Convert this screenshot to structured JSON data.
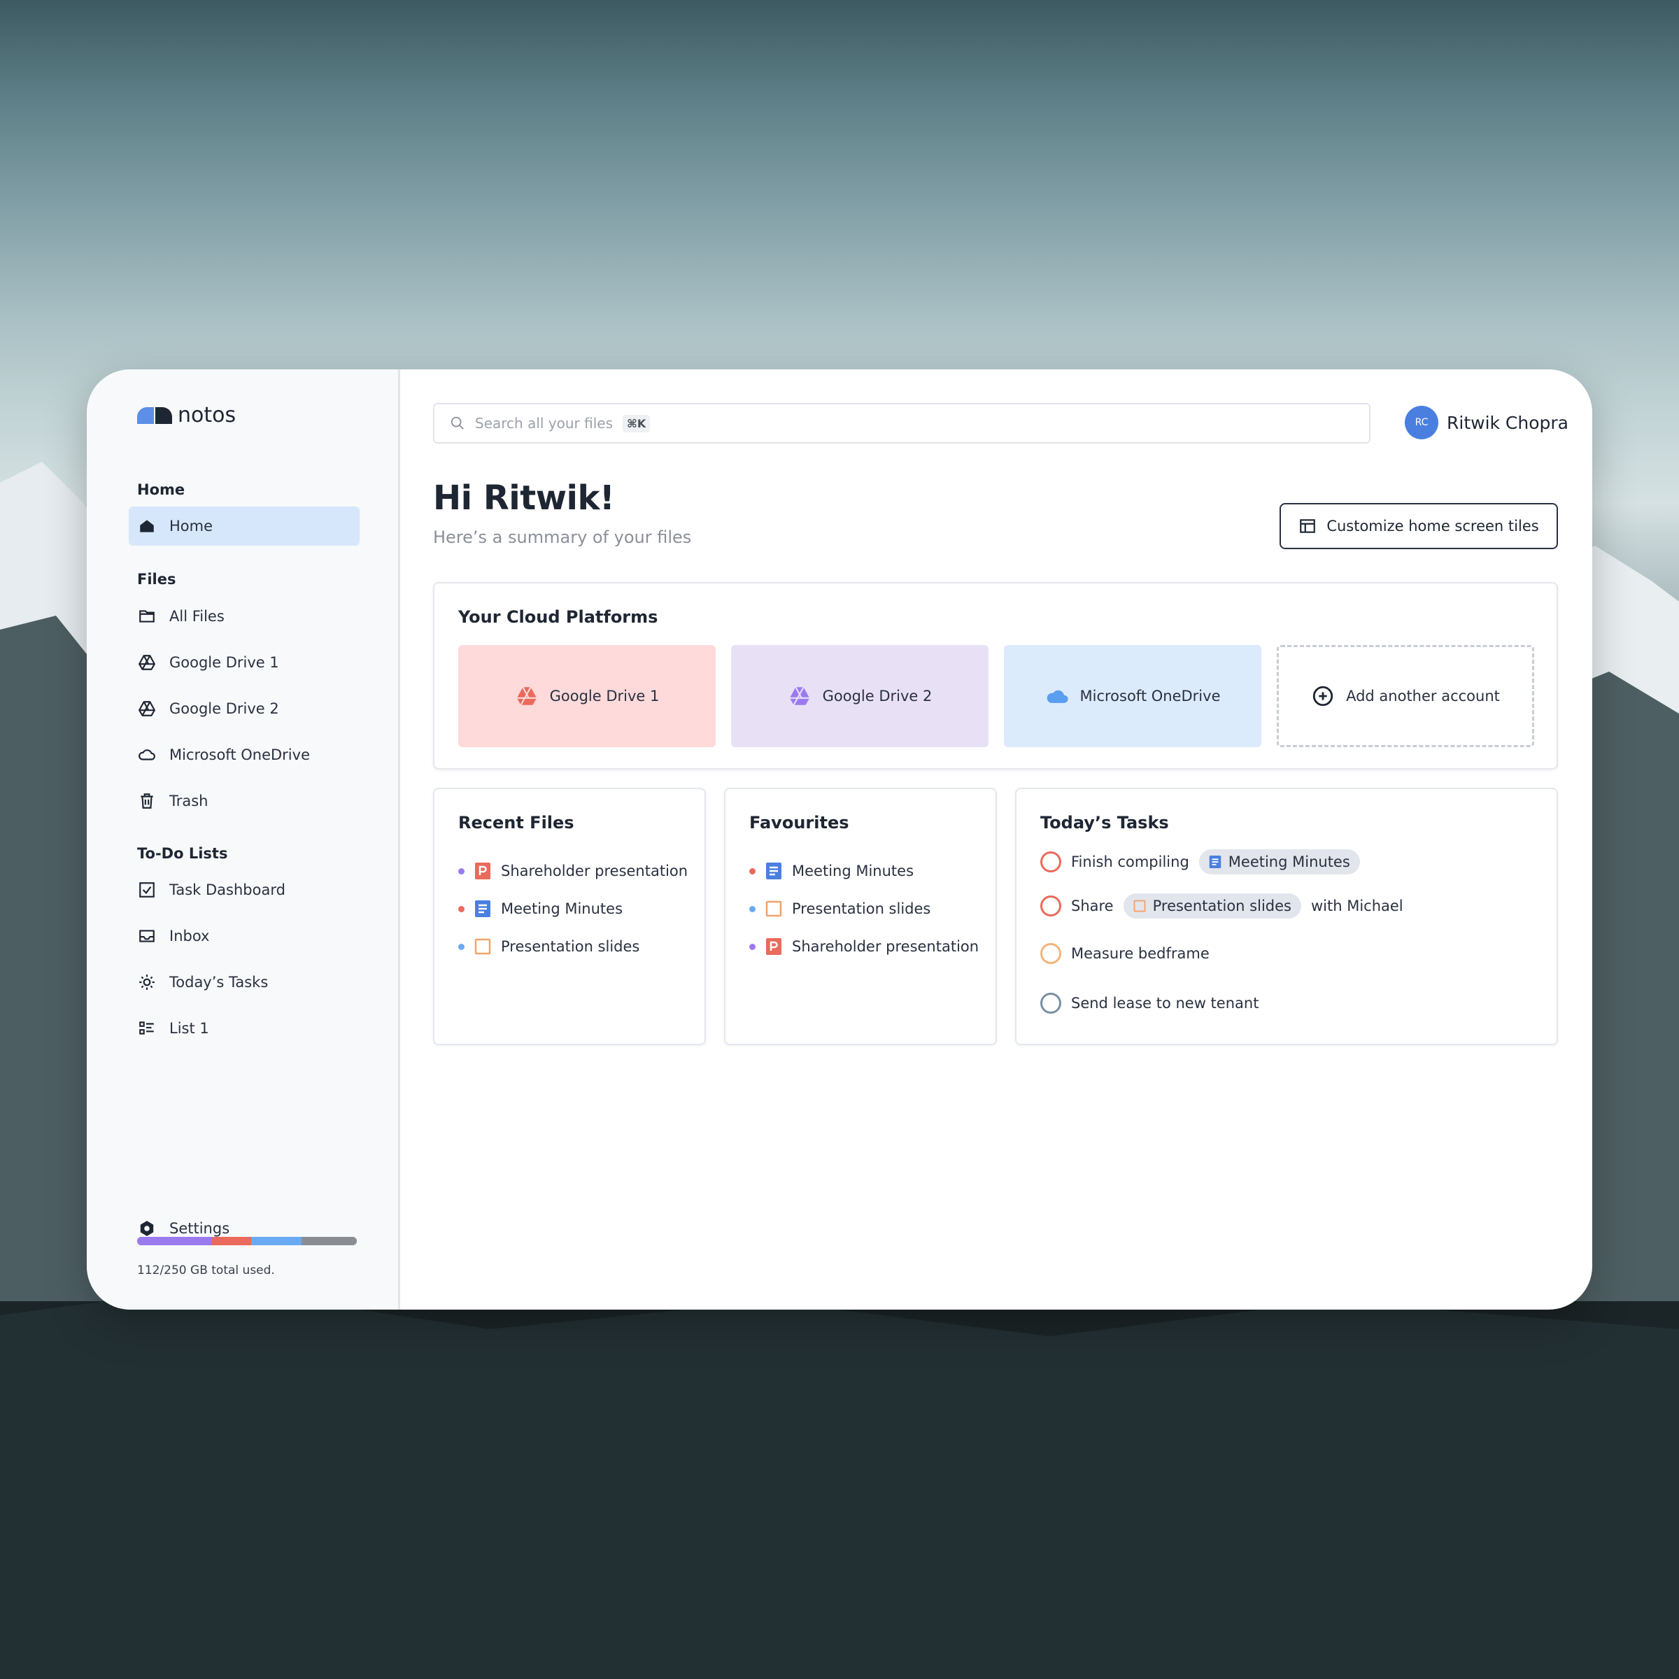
{
  "app": {
    "logo_text": "notos"
  },
  "sidebar": {
    "sections": {
      "home": "Home",
      "files": "Files",
      "todo": "To-Do Lists"
    },
    "items": [
      {
        "label": "Home",
        "icon": "home-icon",
        "active": true
      },
      {
        "label": "All Files",
        "icon": "folder-icon"
      },
      {
        "label": "Google Drive 1",
        "icon": "google-drive-icon"
      },
      {
        "label": "Google Drive 2",
        "icon": "google-drive-icon"
      },
      {
        "label": "Microsoft OneDrive",
        "icon": "cloud-icon"
      },
      {
        "label": "Trash",
        "icon": "trash-icon"
      },
      {
        "label": "Task Dashboard",
        "icon": "checkbox-icon"
      },
      {
        "label": "Inbox",
        "icon": "inbox-icon"
      },
      {
        "label": "Today’s Tasks",
        "icon": "sun-icon"
      },
      {
        "label": "List 1",
        "icon": "list-icon"
      }
    ],
    "settings_label": "Settings",
    "storage": {
      "text": "112/250 GB total used.",
      "used_fraction": 0.448,
      "segments": [
        {
          "color": "#9b7af0",
          "fraction": 0.34
        },
        {
          "color": "#ea6a5c",
          "fraction": 0.18
        },
        {
          "color": "#6aaaf2",
          "fraction": 0.23
        },
        {
          "color": "#8a8d93",
          "fraction": 0.25
        }
      ]
    }
  },
  "header": {
    "search_placeholder": "Search all your files",
    "search_shortcut": "⌘K",
    "user_initials": "RC",
    "user_name": "Ritwik Chopra"
  },
  "main": {
    "greeting": "Hi Ritwik!",
    "subtitle": "Here’s a summary of your files",
    "customize_label": "Customize home screen tiles",
    "cloud": {
      "title": "Your Cloud Platforms",
      "tiles": [
        {
          "label": "Google Drive 1",
          "bg": "#fedadb",
          "icon_color": "#ea6a5c"
        },
        {
          "label": "Google Drive 2",
          "bg": "#e8e1f6",
          "icon_color": "#9b7af0"
        },
        {
          "label": "Microsoft OneDrive",
          "bg": "#dcebfc",
          "icon_color": "#5a9ef0"
        }
      ],
      "add_label": "Add another account"
    },
    "recent": {
      "title": "Recent Files",
      "items": [
        {
          "label": "Shareholder presentation",
          "dot": "#9b7af0",
          "type": "slides-red"
        },
        {
          "label": "Meeting Minutes",
          "dot": "#ea6a5c",
          "type": "doc-blue"
        },
        {
          "label": "Presentation slides",
          "dot": "#6aaaf2",
          "type": "slides-orange"
        }
      ]
    },
    "favourites": {
      "title": "Favourites",
      "items": [
        {
          "label": "Meeting Minutes",
          "dot": "#ea6a5c",
          "type": "doc-blue"
        },
        {
          "label": "Presentation slides",
          "dot": "#6aaaf2",
          "type": "slides-orange"
        },
        {
          "label": "Shareholder presentation",
          "dot": "#9b7af0",
          "type": "slides-red"
        }
      ]
    },
    "tasks": {
      "title": "Today’s Tasks",
      "t1": {
        "prefix": "Finish compiling",
        "chip": "Meeting Minutes",
        "color": "#ea6a5c"
      },
      "t2": {
        "prefix": "Share",
        "chip": "Presentation slides",
        "suffix": "with Michael",
        "color": "#ea6a5c"
      },
      "t3": {
        "label": "Measure bedframe",
        "color": "#f3b47a"
      },
      "t4": {
        "label": "Send lease to new tenant",
        "color": "#7a8fa3"
      }
    }
  }
}
